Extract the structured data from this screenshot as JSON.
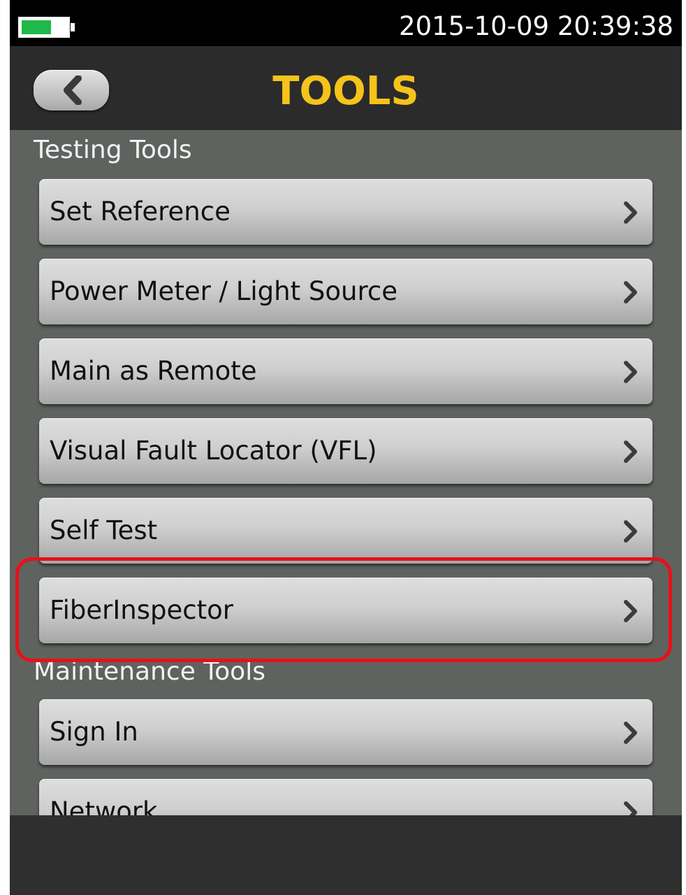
{
  "status": {
    "datetime": "2015-10-09 20:39:38",
    "battery_icon": "battery-icon"
  },
  "header": {
    "title": "TOOLS",
    "back_icon": "back-chevron-icon"
  },
  "sections": {
    "testing": {
      "label": "Testing Tools",
      "items": [
        "Set Reference",
        "Power Meter / Light Source",
        "Main as Remote",
        "Visual Fault Locator (VFL)",
        "Self Test",
        "FiberInspector"
      ]
    },
    "maintenance": {
      "label": "Maintenance Tools",
      "items": [
        "Sign In",
        "Network"
      ]
    }
  },
  "highlighted_item": "FiberInspector",
  "colors": {
    "title": "#f5c31a",
    "highlight": "#e8101a",
    "battery": "#1fb84a"
  }
}
